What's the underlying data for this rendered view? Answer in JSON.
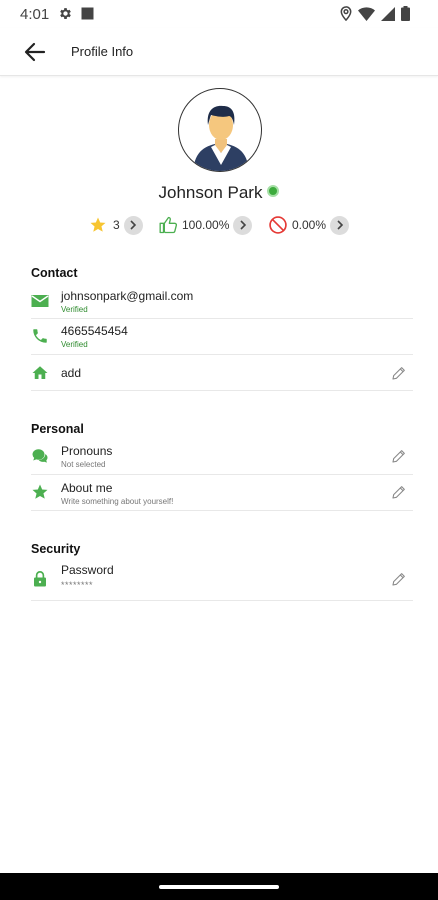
{
  "status_bar": {
    "time": "4:01",
    "left_icons": [
      "gear-icon",
      "square-icon"
    ],
    "right_icons": [
      "location-icon",
      "wifi-icon",
      "signal-icon",
      "battery-icon"
    ]
  },
  "app_bar": {
    "title": "Profile Info"
  },
  "profile": {
    "name": "Johnson Park",
    "online_color": "#3cab3c"
  },
  "stats": {
    "rating": "3",
    "positive": "100.00%",
    "negative": "0.00%"
  },
  "contact": {
    "title": "Contact",
    "email": {
      "value": "johnsonpark@gmail.com",
      "status": "Verified"
    },
    "phone": {
      "value": "4665545454",
      "status": "Verified"
    },
    "address": {
      "value": "add"
    }
  },
  "personal": {
    "title": "Personal",
    "pronouns": {
      "label": "Pronouns",
      "value": "Not selected"
    },
    "about": {
      "label": "About me",
      "value": "Write something about yourself!"
    }
  },
  "security": {
    "title": "Security",
    "password": {
      "label": "Password",
      "value": "********"
    }
  },
  "colors": {
    "accent_green": "#4caf50",
    "verified_green": "#2e8b2e",
    "star_yellow": "#f7c531",
    "block_red": "#e53935"
  }
}
